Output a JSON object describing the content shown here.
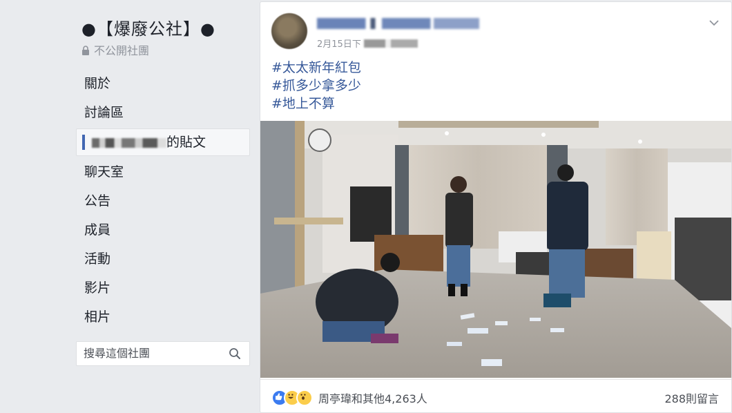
{
  "group": {
    "title": "●【爆廢公社】●",
    "privacy": "不公開社團"
  },
  "nav": {
    "items": [
      {
        "label": "關於"
      },
      {
        "label": "討論區"
      },
      {
        "label": "的貼文"
      },
      {
        "label": "聊天室"
      },
      {
        "label": "公告"
      },
      {
        "label": "成員"
      },
      {
        "label": "活動"
      },
      {
        "label": "影片"
      },
      {
        "label": "相片"
      }
    ]
  },
  "search": {
    "placeholder": "搜尋這個社團"
  },
  "post": {
    "date_prefix": "2月15日下",
    "hashtags": [
      "#太太新年紅包",
      "#抓多少拿多少",
      "#地上不算"
    ],
    "reactions_text": "周亭瑋和其他4,263人",
    "comments_text": "288則留言"
  },
  "icons": {
    "lock": "lock-icon",
    "search": "search-icon",
    "chevron": "chevron-down-icon",
    "like": "like-reaction-icon",
    "haha": "haha-reaction-icon",
    "wow": "wow-reaction-icon"
  },
  "colors": {
    "background": "#e9ebee",
    "link": "#365899",
    "accent": "#4267b2"
  }
}
